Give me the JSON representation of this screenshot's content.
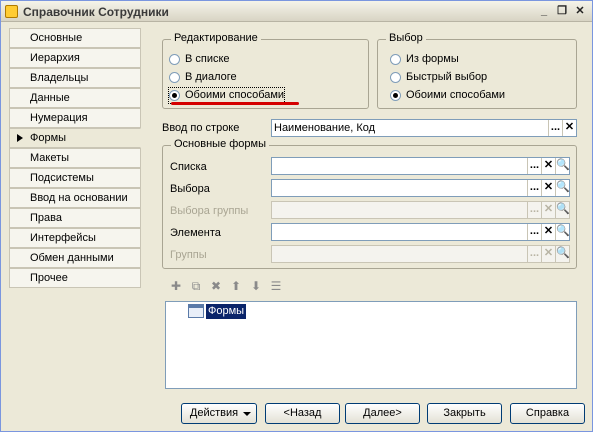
{
  "window": {
    "title": "Справочник Сотрудники"
  },
  "titlebar_controls": {
    "minimize": "_",
    "restore": "❐",
    "close": "✕"
  },
  "sidebar": {
    "items": [
      {
        "label": "Основные"
      },
      {
        "label": "Иерархия"
      },
      {
        "label": "Владельцы"
      },
      {
        "label": "Данные"
      },
      {
        "label": "Нумерация"
      },
      {
        "label": "Формы",
        "active": true
      },
      {
        "label": "Макеты"
      },
      {
        "label": "Подсистемы"
      },
      {
        "label": "Ввод на основании"
      },
      {
        "label": "Права"
      },
      {
        "label": "Интерфейсы"
      },
      {
        "label": "Обмен данными"
      },
      {
        "label": "Прочее"
      }
    ]
  },
  "editing_group": {
    "title": "Редактирование",
    "options": [
      "В списке",
      "В диалоге",
      "Обоими способами"
    ],
    "selected": "Обоими способами"
  },
  "selection_group": {
    "title": "Выбор",
    "options": [
      "Из формы",
      "Быстрый выбор",
      "Обоими способами"
    ],
    "selected": "Обоими способами"
  },
  "input_by_string": {
    "label": "Ввод по строке",
    "value": "Наименование, Код"
  },
  "main_forms": {
    "title": "Основные формы",
    "rows": [
      {
        "label": "Списка",
        "value": "",
        "enabled": true
      },
      {
        "label": "Выбора",
        "value": "",
        "enabled": true
      },
      {
        "label": "Выбора группы",
        "value": "",
        "enabled": false
      },
      {
        "label": "Элемента",
        "value": "",
        "enabled": true
      },
      {
        "label": "Группы",
        "value": "",
        "enabled": false
      }
    ]
  },
  "field_buttons": {
    "select": "...",
    "clear": "✕",
    "open": "🔍"
  },
  "tree": {
    "root": "Формы"
  },
  "footer": {
    "actions": "Действия",
    "back": "<Назад",
    "next": "Далее>",
    "close": "Закрыть",
    "help": "Справка"
  },
  "colors": {
    "selection": "#0a246a",
    "highlight_underline": "#d40000",
    "window_bg": "#ece9d8"
  }
}
